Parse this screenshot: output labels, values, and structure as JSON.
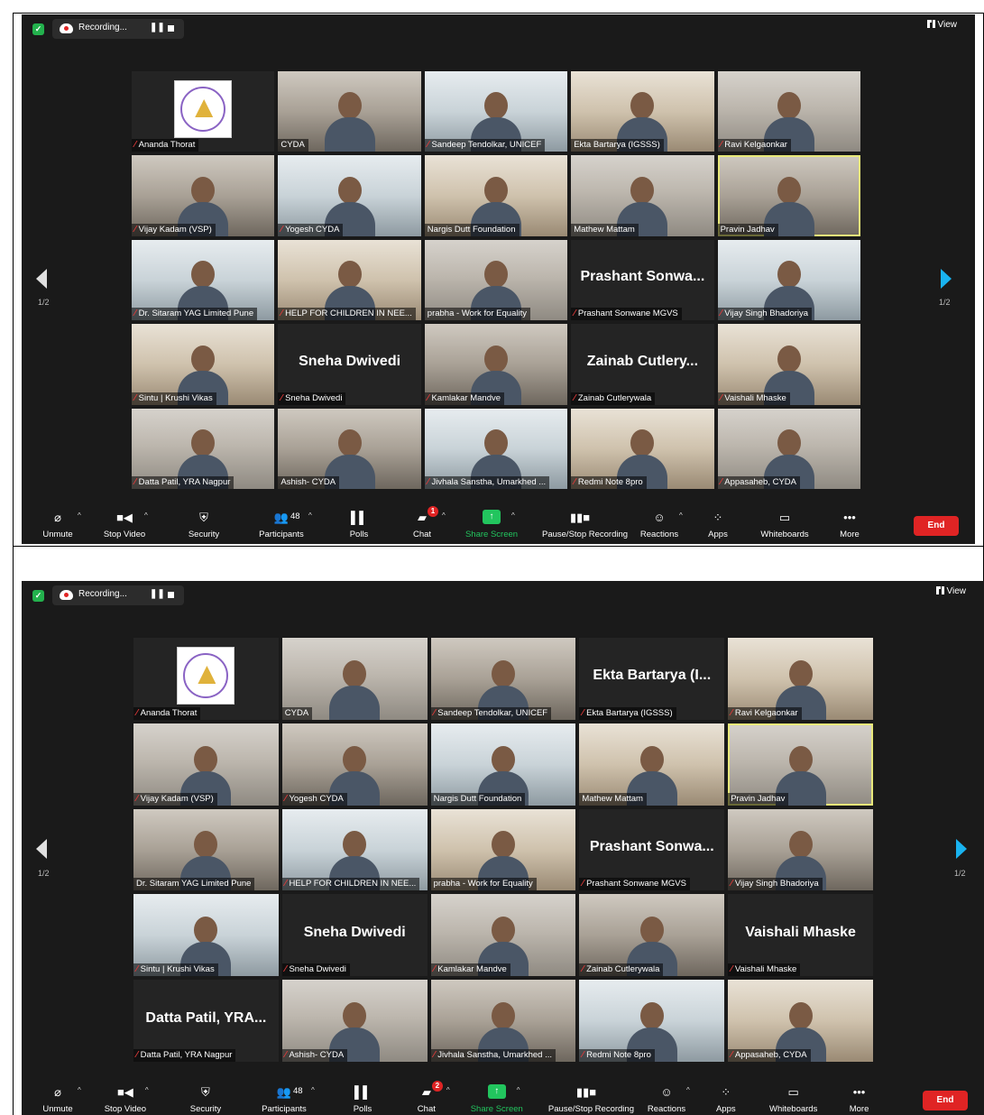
{
  "recording_label": "Recording...",
  "view_label": "View",
  "page_indicator": "1/2",
  "screens": [
    {
      "chat_badge": "1",
      "participants_count": "48",
      "tiles": [
        {
          "name": "Ananda Thorat",
          "kind": "logo",
          "muted": true
        },
        {
          "name": "CYDA",
          "kind": "video",
          "muted": false
        },
        {
          "name": "Sandeep Tendolkar, UNICEF",
          "kind": "video",
          "muted": true
        },
        {
          "name": "Ekta Bartarya (IGSSS)",
          "kind": "video",
          "muted": false
        },
        {
          "name": "Ravi Kelgaonkar",
          "kind": "video",
          "muted": true
        },
        {
          "name": "Vijay Kadam (VSP)",
          "kind": "video",
          "muted": true
        },
        {
          "name": "Yogesh CYDA",
          "kind": "video",
          "muted": true
        },
        {
          "name": "Nargis Dutt Foundation",
          "kind": "video",
          "muted": false
        },
        {
          "name": "Mathew Mattam",
          "kind": "video",
          "muted": false
        },
        {
          "name": "Pravin Jadhav",
          "kind": "video",
          "muted": false,
          "active": true
        },
        {
          "name": "Dr. Sitaram YAG Limited Pune",
          "kind": "video",
          "muted": true
        },
        {
          "name": "HELP FOR CHILDREN IN NEE...",
          "kind": "video",
          "muted": true
        },
        {
          "name": "prabha - Work for Equality",
          "kind": "video",
          "muted": false
        },
        {
          "name": "Prashant Sonwane MGVS",
          "kind": "name",
          "big": "Prashant  Sonwa...",
          "muted": true
        },
        {
          "name": "Vijay Singh Bhadoriya",
          "kind": "video",
          "muted": true
        },
        {
          "name": "Sintu | Krushi Vikas",
          "kind": "video",
          "muted": true
        },
        {
          "name": "Sneha Dwivedi",
          "kind": "name",
          "big": "Sneha Dwivedi",
          "muted": true
        },
        {
          "name": "Kamlakar Mandve",
          "kind": "video",
          "muted": true
        },
        {
          "name": "Zainab Cutlerywala",
          "kind": "name",
          "big": "Zainab  Cutlery...",
          "muted": true
        },
        {
          "name": "Vaishali Mhaske",
          "kind": "video",
          "muted": true
        },
        {
          "name": "Datta Patil, YRA Nagpur",
          "kind": "video",
          "muted": true
        },
        {
          "name": "Ashish- CYDA",
          "kind": "video",
          "muted": false
        },
        {
          "name": "Jivhala Sanstha, Umarkhed ...",
          "kind": "video",
          "muted": true
        },
        {
          "name": "Redmi Note 8pro",
          "kind": "video",
          "muted": true
        },
        {
          "name": "Appasaheb, CYDA",
          "kind": "video",
          "muted": true
        }
      ]
    },
    {
      "chat_badge": "2",
      "participants_count": "48",
      "tiles": [
        {
          "name": "Ananda Thorat",
          "kind": "logo",
          "muted": true
        },
        {
          "name": "CYDA",
          "kind": "video",
          "muted": false
        },
        {
          "name": "Sandeep Tendolkar, UNICEF",
          "kind": "video",
          "muted": true
        },
        {
          "name": "Ekta Bartarya (IGSSS)",
          "kind": "name",
          "big": "Ekta  Bartarya  (I...",
          "muted": true
        },
        {
          "name": "Ravi Kelgaonkar",
          "kind": "video",
          "muted": true
        },
        {
          "name": "Vijay Kadam (VSP)",
          "kind": "video",
          "muted": true
        },
        {
          "name": "Yogesh CYDA",
          "kind": "video",
          "muted": true
        },
        {
          "name": "Nargis Dutt Foundation",
          "kind": "video",
          "muted": false
        },
        {
          "name": "Mathew Mattam",
          "kind": "video",
          "muted": false
        },
        {
          "name": "Pravin Jadhav",
          "kind": "video",
          "muted": false,
          "active": true
        },
        {
          "name": "Dr. Sitaram YAG Limited Pune",
          "kind": "video",
          "muted": false
        },
        {
          "name": "HELP FOR CHILDREN IN NEE...",
          "kind": "video",
          "muted": true
        },
        {
          "name": "prabha - Work for Equality",
          "kind": "video",
          "muted": false
        },
        {
          "name": "Prashant Sonwane MGVS",
          "kind": "name",
          "big": "Prashant  Sonwa...",
          "muted": true
        },
        {
          "name": "Vijay Singh Bhadoriya",
          "kind": "video",
          "muted": true
        },
        {
          "name": "Sintu | Krushi Vikas",
          "kind": "video",
          "muted": true
        },
        {
          "name": "Sneha Dwivedi",
          "kind": "name",
          "big": "Sneha Dwivedi",
          "muted": true
        },
        {
          "name": "Kamlakar Mandve",
          "kind": "video",
          "muted": true
        },
        {
          "name": "Zainab Cutlerywala",
          "kind": "video",
          "muted": true
        },
        {
          "name": "Vaishali Mhaske",
          "kind": "name",
          "big": "Vaishali Mhaske",
          "muted": true
        },
        {
          "name": "Datta Patil, YRA Nagpur",
          "kind": "name",
          "big": "Datta  Patil,  YRA...",
          "muted": true
        },
        {
          "name": "Ashish- CYDA",
          "kind": "video",
          "muted": true
        },
        {
          "name": "Jivhala Sanstha, Umarkhed ...",
          "kind": "video",
          "muted": true
        },
        {
          "name": "Redmi Note 8pro",
          "kind": "video",
          "muted": true
        },
        {
          "name": "Appasaheb, CYDA",
          "kind": "video",
          "muted": true
        }
      ]
    }
  ],
  "toolbar": {
    "unmute": "Unmute",
    "stop_video": "Stop Video",
    "security": "Security",
    "participants": "Participants",
    "polls": "Polls",
    "chat": "Chat",
    "share_screen": "Share Screen",
    "pause_stop_recording": "Pause/Stop Recording",
    "reactions": "Reactions",
    "apps": "Apps",
    "whiteboards": "Whiteboards",
    "more": "More",
    "end": "End"
  },
  "icons": {
    "mic": "mic-muted-icon",
    "video": "video-camera-icon",
    "security": "shield-icon",
    "participants": "people-icon",
    "polls": "bar-chart-icon",
    "chat": "chat-bubble-icon",
    "share": "share-up-arrow-icon",
    "record": "pause-stop-icon",
    "reactions": "smiley-plus-icon",
    "apps": "apps-icon",
    "whiteboards": "whiteboard-icon",
    "more": "ellipsis-icon"
  },
  "colors": {
    "end": "#e02424",
    "share": "#22c55e",
    "active_speaker": "#e8e87a",
    "next_arrow": "#19b3f0"
  }
}
